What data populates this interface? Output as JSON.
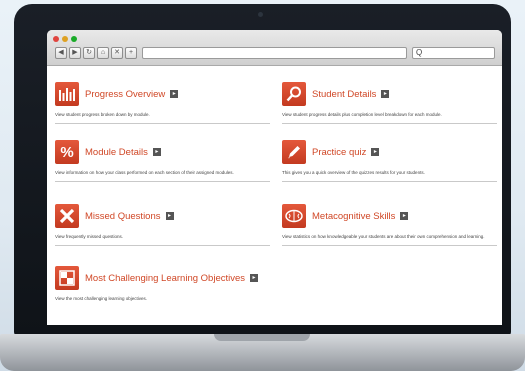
{
  "browser": {
    "back_glyph": "◀",
    "forward_glyph": "▶",
    "reload_glyph": "↻",
    "home_glyph": "⌂",
    "stop_glyph": "✕",
    "add_glyph": "+",
    "search_glyph": "Q"
  },
  "cards": [
    {
      "title": "Progress Overview",
      "description": "View student progress broken down by module.",
      "icon": "bar-chart-icon"
    },
    {
      "title": "Student Details",
      "description": "View student progress details plus completion level breakdown for each module.",
      "icon": "magnifier-icon"
    },
    {
      "title": "Module Details",
      "description": "View information on how your class performed on each section of their assigned modules.",
      "icon": "percent-icon"
    },
    {
      "title": "Practice quiz",
      "description": "This gives you a quick overview of the quizzes results for your students.",
      "icon": "pencil-icon"
    },
    {
      "title": "Missed Questions",
      "description": "View frequently missed questions.",
      "icon": "x-mark-icon"
    },
    {
      "title": "Metacognitive Skills",
      "description": "View statistics on how knowledgeable your students are about their own comprehension and learning.",
      "icon": "brain-icon"
    },
    {
      "title": "Most Challenging Learning Objectives",
      "description": "View the most challenging learning objectives.",
      "icon": "grid-icon"
    }
  ],
  "colors": {
    "accent": "#d04726",
    "tile": "#d9492c"
  }
}
